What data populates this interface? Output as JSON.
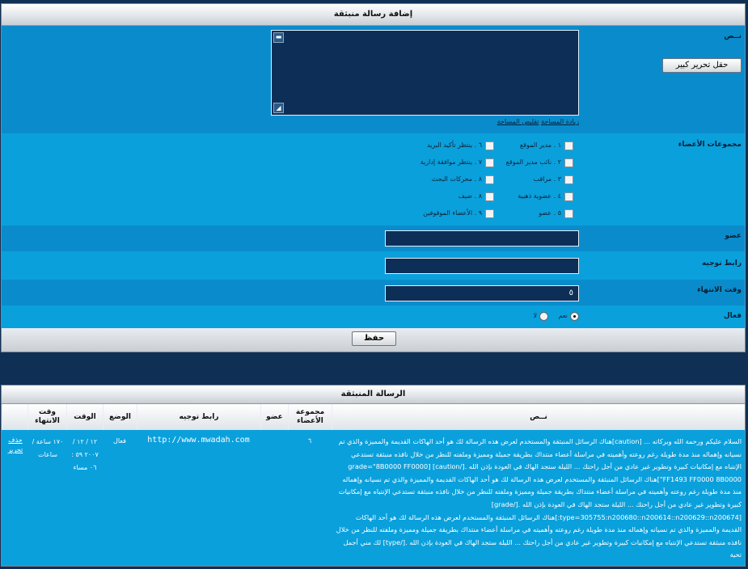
{
  "form": {
    "title": "إضافة رسالة منبثقة",
    "text_label": "نــص",
    "big_editor_button": "حقل تحرير كبير",
    "increase_area": "زيادة المساحة",
    "decrease_area": "تقليص المساحة",
    "groups_label": "مجموعات الأعضاء",
    "groups": [
      {
        "label": "١ . مدير الموقع",
        "checked": false
      },
      {
        "label": "٦ . ينتظر تأكيد البريد",
        "checked": false
      },
      {
        "label": "٢ . نائب مدير الموقع",
        "checked": false
      },
      {
        "label": "٧ . ينتظر موافقة إدارية",
        "checked": false
      },
      {
        "label": "٣ . مراقب",
        "checked": false
      },
      {
        "label": "٨ . محركات البحث",
        "checked": false
      },
      {
        "label": "٤ . عضوية ذهبية",
        "checked": false
      },
      {
        "label": "٨ . ضيف",
        "checked": false
      },
      {
        "label": "٥ . عضو",
        "checked": false
      },
      {
        "label": "٩ . الأعضاء الموقوفين",
        "checked": false
      }
    ],
    "member_label": "عضو",
    "member_value": "",
    "redirect_label": "رابط توجيه",
    "redirect_value": "",
    "expire_label": "وقت الانتهاء",
    "expire_value": "٥",
    "active_label": "فعال",
    "yes_label": "نعم",
    "no_label": "لا",
    "active_selected": "yes",
    "save_button": "حفظ"
  },
  "list": {
    "title": "الرسالة المنبثقة",
    "headers": {
      "text": "نــص",
      "group": "مجموعة الأعضاء",
      "member": "عضو",
      "redirect": "رابط توجيه",
      "status": "الوضع",
      "time": "الوقت",
      "expire": "وقت الانتهاء"
    },
    "row": {
      "text": "السلام عليكم ورحمة الله وبركاته ... [caution]هناك الرسائل المنبثقة والمستخدم لعرض هذه الرسالة لك هو أحد الهاكات القديمة والمميزة والذي تم نسيانه وإهماله منذ مدة طويلة رغم روعته وأهميته في مراسلة أعضاء منتداك بطريقة جميلة ومميزة وملفته للنظر من خلال نافذه منبثقة تستدعي الإنتباه مع إمكانيات كبيرة وتطوير غير عادي من أجل راحتك ... الليلة ستجد الهاك في العودة بإذن الله .[/caution] [grade=\"8B0000 FF0000 FF1493 FF0000 8B0000\"]هناك الرسائل المنبثقة والمستخدم لعرض هذه الرسالة لك هو أحد الهاكات القديمة والمميزة والذي تم نسيانه وإهماله منذ مدة طويلة رغم روعته وأهميته في مراسلة أعضاء منتداك بطريقة جميلة ومميزة وملفته للنظر من خلال نافذه منبثقة تستدعي الإنتباه مع إمكانيات كبيرة وتطوير غير عادي من أجل راحتك ... الليلة ستجد الهاك في العودة بإذن الله .[/grade] [type=305755:n200680::n200614::n200629::n200674:]هناك الرسائل المنبثقة والمستخدم لعرض هذه الرسالة لك هو أحد الهاكات القديمة والمميزة والذي تم نسيانه وإهماله منذ مدة طويلة رغم روعته وأهميته في مراسلة أعضاء منتداك بطريقة جميلة ومميزة وملفته للنظر من خلال نافذه منبثقة تستدعي الإنتباه مع إمكانيات كبيرة وتطوير غير عادي من أجل راحتك ... الليلة ستجد الهاك في العودة بإذن الله .[/type] لك مني أجمل تحية",
      "group": "٦",
      "member": "",
      "redirect": "http://www.mwadah.com",
      "status": "فعال",
      "time": "١٢ / ١٢ / ٢٠٠٧ ٥٩ : ٠٦ مساء",
      "expire": "١٧٠ ساعة / ساعات",
      "delete": "حذف",
      "edit": "تحرير"
    }
  },
  "colors": {
    "panel_bg": "#0aa0dc",
    "row_alt": "#0a8ccc",
    "textarea_bg": "#0d2e57",
    "page_bg": "#0f2f55"
  }
}
